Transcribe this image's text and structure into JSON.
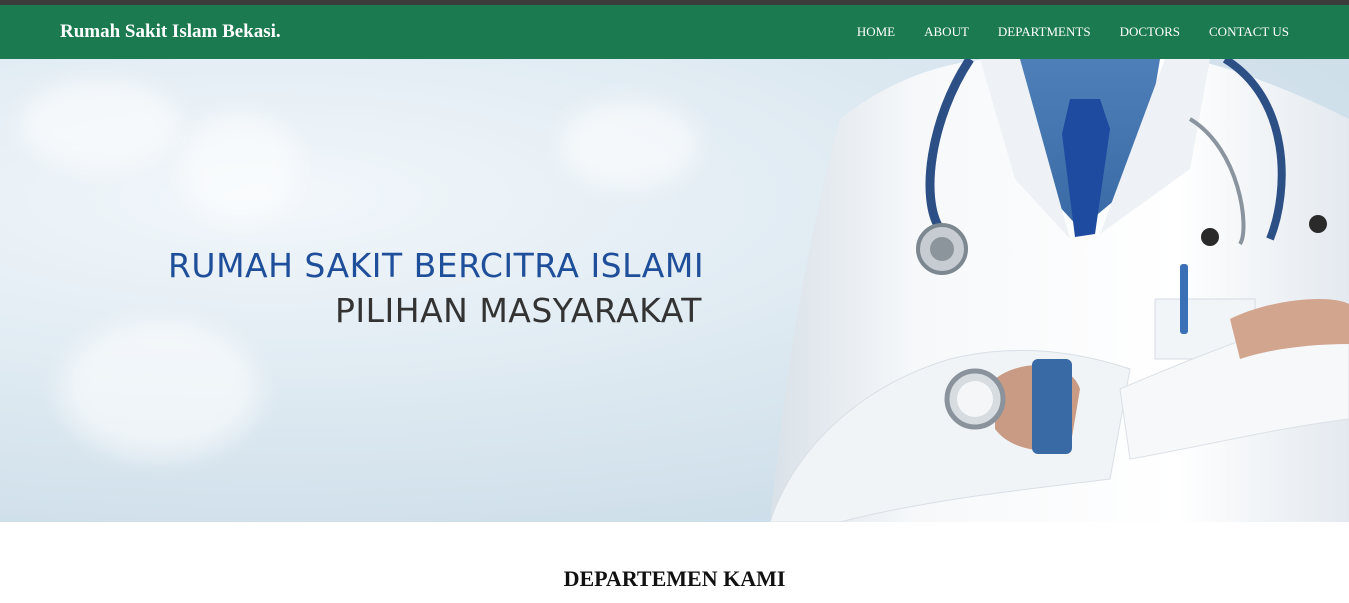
{
  "brand": "Rumah Sakit Islam Bekasi.",
  "nav": {
    "items": [
      {
        "label": "HOME"
      },
      {
        "label": "ABOUT"
      },
      {
        "label": "DEPARTMENTS"
      },
      {
        "label": "DOCTORS"
      },
      {
        "label": "CONTACT US"
      }
    ]
  },
  "hero": {
    "title": "RUMAH SAKIT BERCITRA ISLAMI",
    "subtitle": "PILIHAN MASYARAKAT",
    "image": "doctor-with-stethoscope-arms-crossed"
  },
  "section": {
    "title": "DEPARTEMEN KAMI"
  },
  "colors": {
    "navbar": "#1b7a4f",
    "hero_title": "#1f4f9a",
    "hero_subtitle": "#333333"
  }
}
